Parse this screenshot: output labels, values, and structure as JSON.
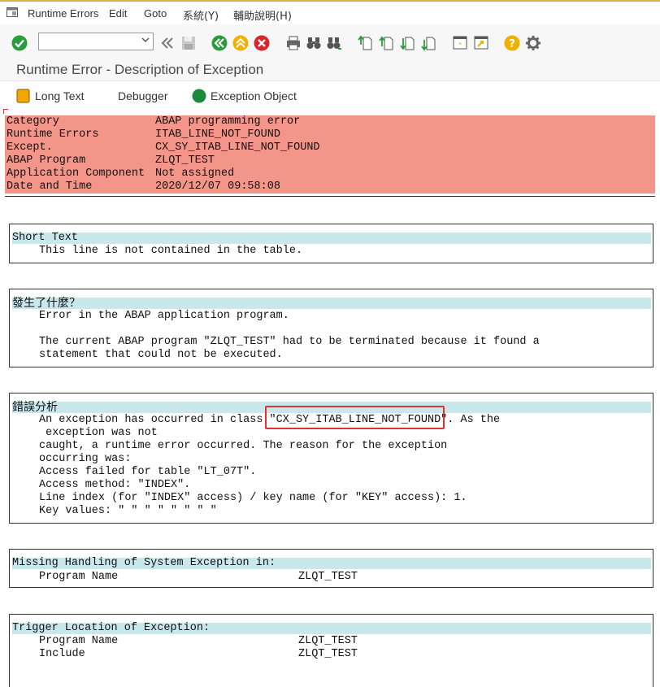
{
  "menubar": {
    "items": [
      "Runtime Errors",
      "Edit",
      "Goto",
      "系統(Y)",
      "輔助說明(H)"
    ]
  },
  "toolbar": {
    "command_value": ""
  },
  "title": "Runtime Error - Description of Exception",
  "app_toolbar": {
    "long_text": "Long Text",
    "debugger": "Debugger",
    "exception_object": "Exception Object"
  },
  "header_fields": [
    {
      "label": "Category",
      "value": "ABAP programming error"
    },
    {
      "label": "Runtime Errors",
      "value": "ITAB_LINE_NOT_FOUND"
    },
    {
      "label": "Except.",
      "value": "CX_SY_ITAB_LINE_NOT_FOUND"
    },
    {
      "label": "ABAP Program",
      "value": "ZLQT_TEST"
    },
    {
      "label": "Application Component",
      "value": "Not assigned"
    },
    {
      "label": "Date and Time",
      "value": "2020/12/07 09:58:08"
    }
  ],
  "short_text": {
    "heading": "Short Text",
    "text": "This line is not contained in the table."
  },
  "what_happened": {
    "heading": "發生了什麼？",
    "line1": "Error in the ABAP application program.",
    "line2": "The current ABAP program \"ZLQT_TEST\" had to be terminated because it found a",
    "line3": "statement that could not be executed."
  },
  "error_analysis": {
    "heading": "錯誤分析",
    "line1_pre": "An exception has occurred in class ",
    "line1_class": "\"CX_SY_ITAB_LINE_NOT_FOUND\"",
    "line1_post": ". As the",
    "line2": " exception was not",
    "line3": "caught, a runtime error occurred. The reason for the exception",
    "line4": "occurring was:",
    "line5": "Access failed for table \"LT_07T\".",
    "line6": "Access method: \"INDEX\".",
    "line7": "Line index (for \"INDEX\" access) / key name (for \"KEY\" access): 1.",
    "line8": "Key values: \" \" \" \" \" \" \" \""
  },
  "missing_handling": {
    "heading": "Missing Handling of System Exception in:",
    "program_label": "Program Name",
    "program_value": "ZLQT_TEST"
  },
  "trigger_location": {
    "heading": "Trigger Location of Exception:",
    "program_label": "Program Name",
    "program_value": "ZLQT_TEST",
    "include_label": "Include",
    "include_value": "ZLQT_TEST"
  },
  "colors": {
    "header_bg": "#f4958a",
    "section_heading_bg": "#c8e8ee",
    "highlight_box": "#e53030"
  }
}
